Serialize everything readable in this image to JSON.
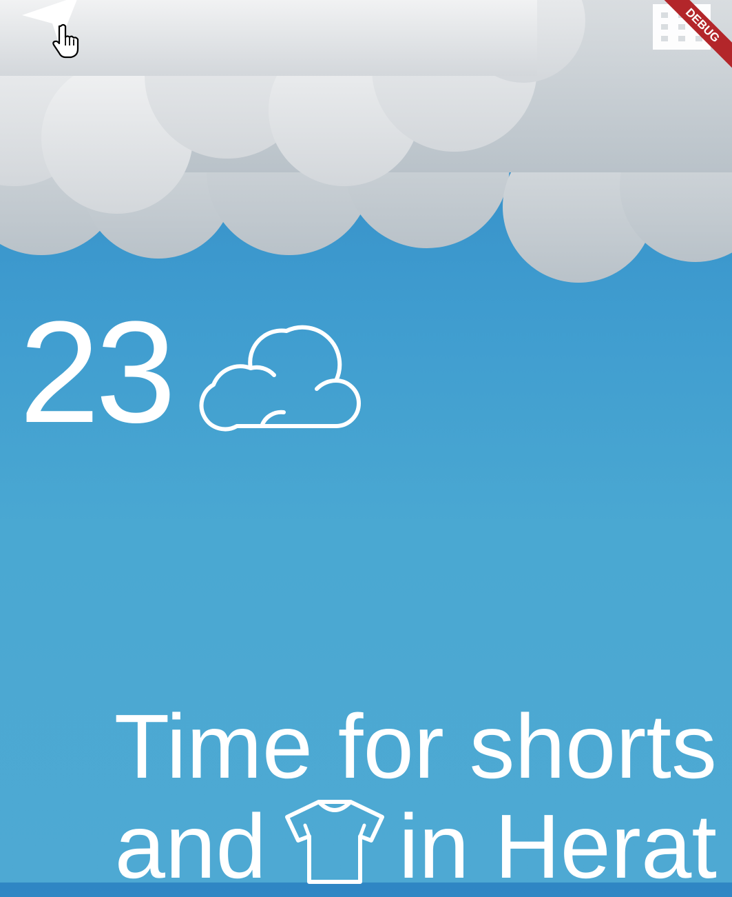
{
  "app": {
    "debug_banner": "DEBUG"
  },
  "colors": {
    "sky_top": "#2f86c4",
    "sky_bottom": "#4ea9d3",
    "cloud": "#e6e8ea",
    "sun": "#e8b21f",
    "debug": "#b3262a"
  },
  "toolbar": {
    "location_icon": "navigation-arrow-icon",
    "menu_icon": "grid-icon"
  },
  "weather": {
    "temperature": "23",
    "condition_icon": "cloud-icon"
  },
  "message": {
    "line1": "Time for shorts",
    "line2_prefix": "and",
    "line2_icon": "t-shirt-icon",
    "line2_suffix": "in Herat"
  }
}
